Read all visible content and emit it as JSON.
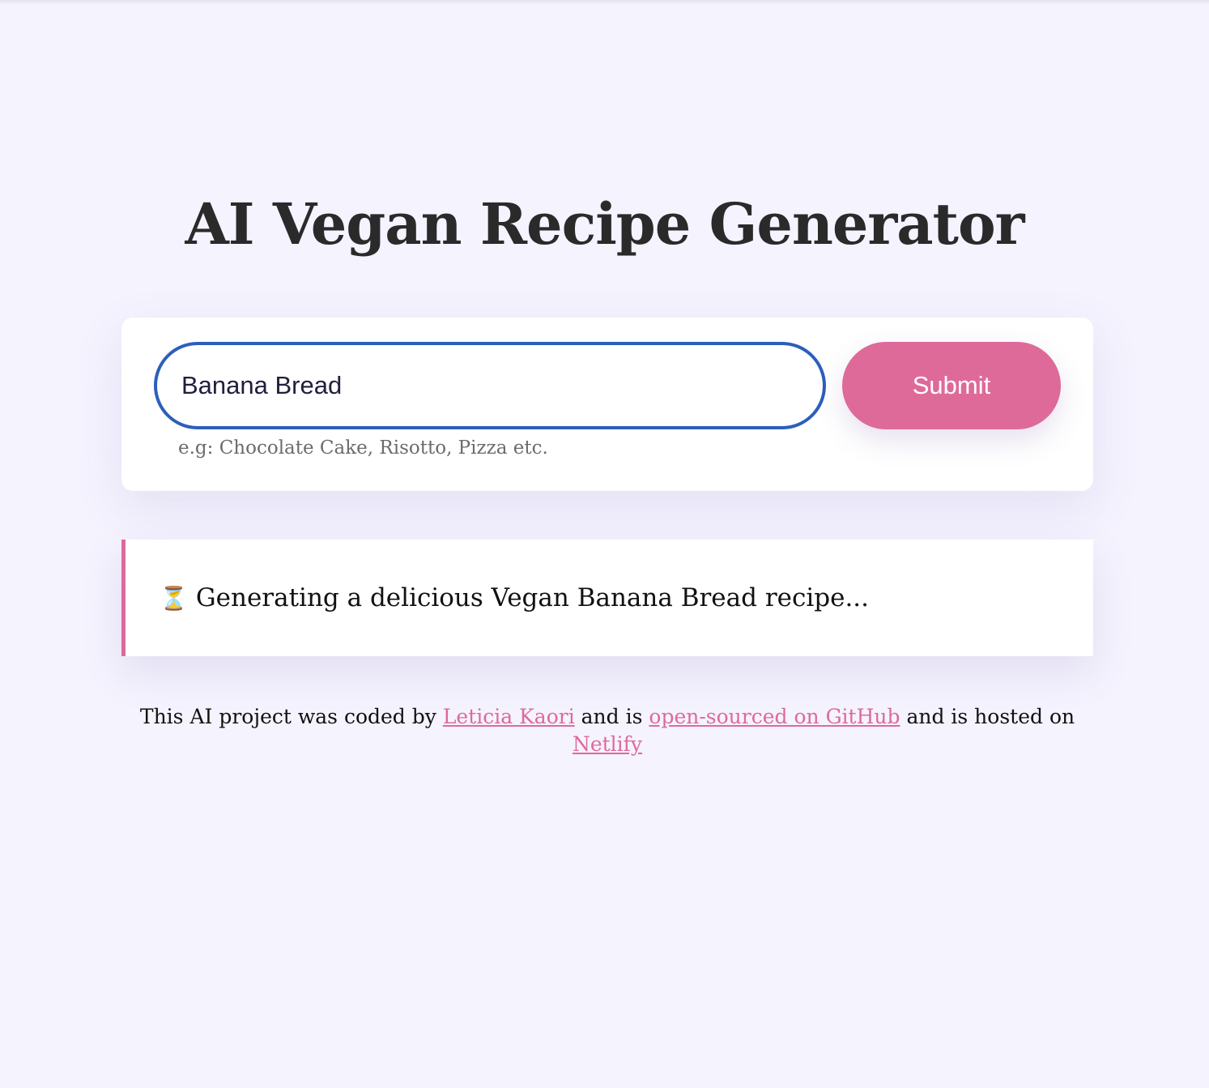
{
  "header": {
    "title": "AI Vegan Recipe Generator"
  },
  "form": {
    "input_value": "Banana Bread",
    "hint": "e.g: Chocolate Cake, Risotto, Pizza etc.",
    "submit_label": "Submit"
  },
  "status": {
    "icon": "hourglass-icon",
    "icon_glyph": "⏳",
    "message": "Generating a delicious Vegan Banana Bread recipe..."
  },
  "footer": {
    "text_1": "This AI project was coded by ",
    "author_link": "Leticia Kaori",
    "text_2": " and is ",
    "github_link": "open-sourced on GitHub",
    "text_3": " and is hosted on ",
    "netlify_link": "Netlify"
  },
  "colors": {
    "background": "#f5f3fe",
    "accent": "#de6a9a",
    "input_border": "#2b5fba"
  }
}
